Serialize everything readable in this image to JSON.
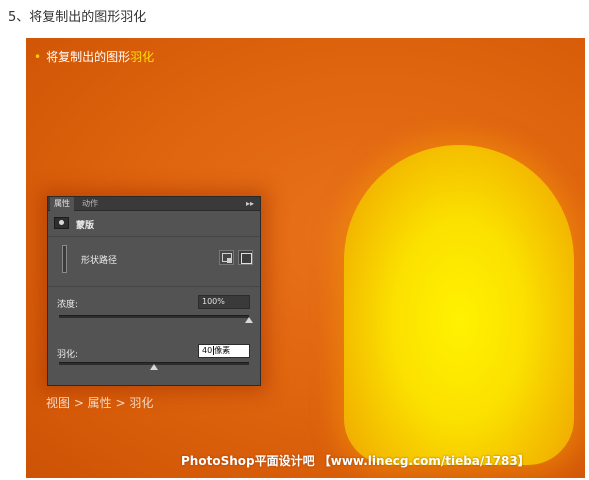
{
  "step_heading": "5、将复制出的图形羽化",
  "caption": {
    "text": "将复制出的图形",
    "highlight": "羽化"
  },
  "panel": {
    "tabs": [
      {
        "label": "属性",
        "active": true
      },
      {
        "label": "动作",
        "active": false
      }
    ],
    "menu_glyph": "▸▸",
    "mask_label": "蒙版",
    "shape_label": "形状路径",
    "density": {
      "label": "浓度:",
      "value": "100%",
      "level_percent": 100
    },
    "feather": {
      "label": "羽化:",
      "value_number": "40",
      "value_unit": "像素",
      "level_fraction": 0.5
    }
  },
  "menu_path": "视图 > 属性 > 羽化",
  "watermark": "PhotoShop平面设计吧 【www.linecg.com/tieba/1783】",
  "colors": {
    "canvas_orange": "#e0660f",
    "glow_yellow": "#fff200",
    "highlight_yellow": "#ffe100",
    "panel_gray": "#535353"
  },
  "icons": [
    "mask-icon",
    "vector-mask-icon",
    "select-mask-icon",
    "panel-menu-icon"
  ]
}
